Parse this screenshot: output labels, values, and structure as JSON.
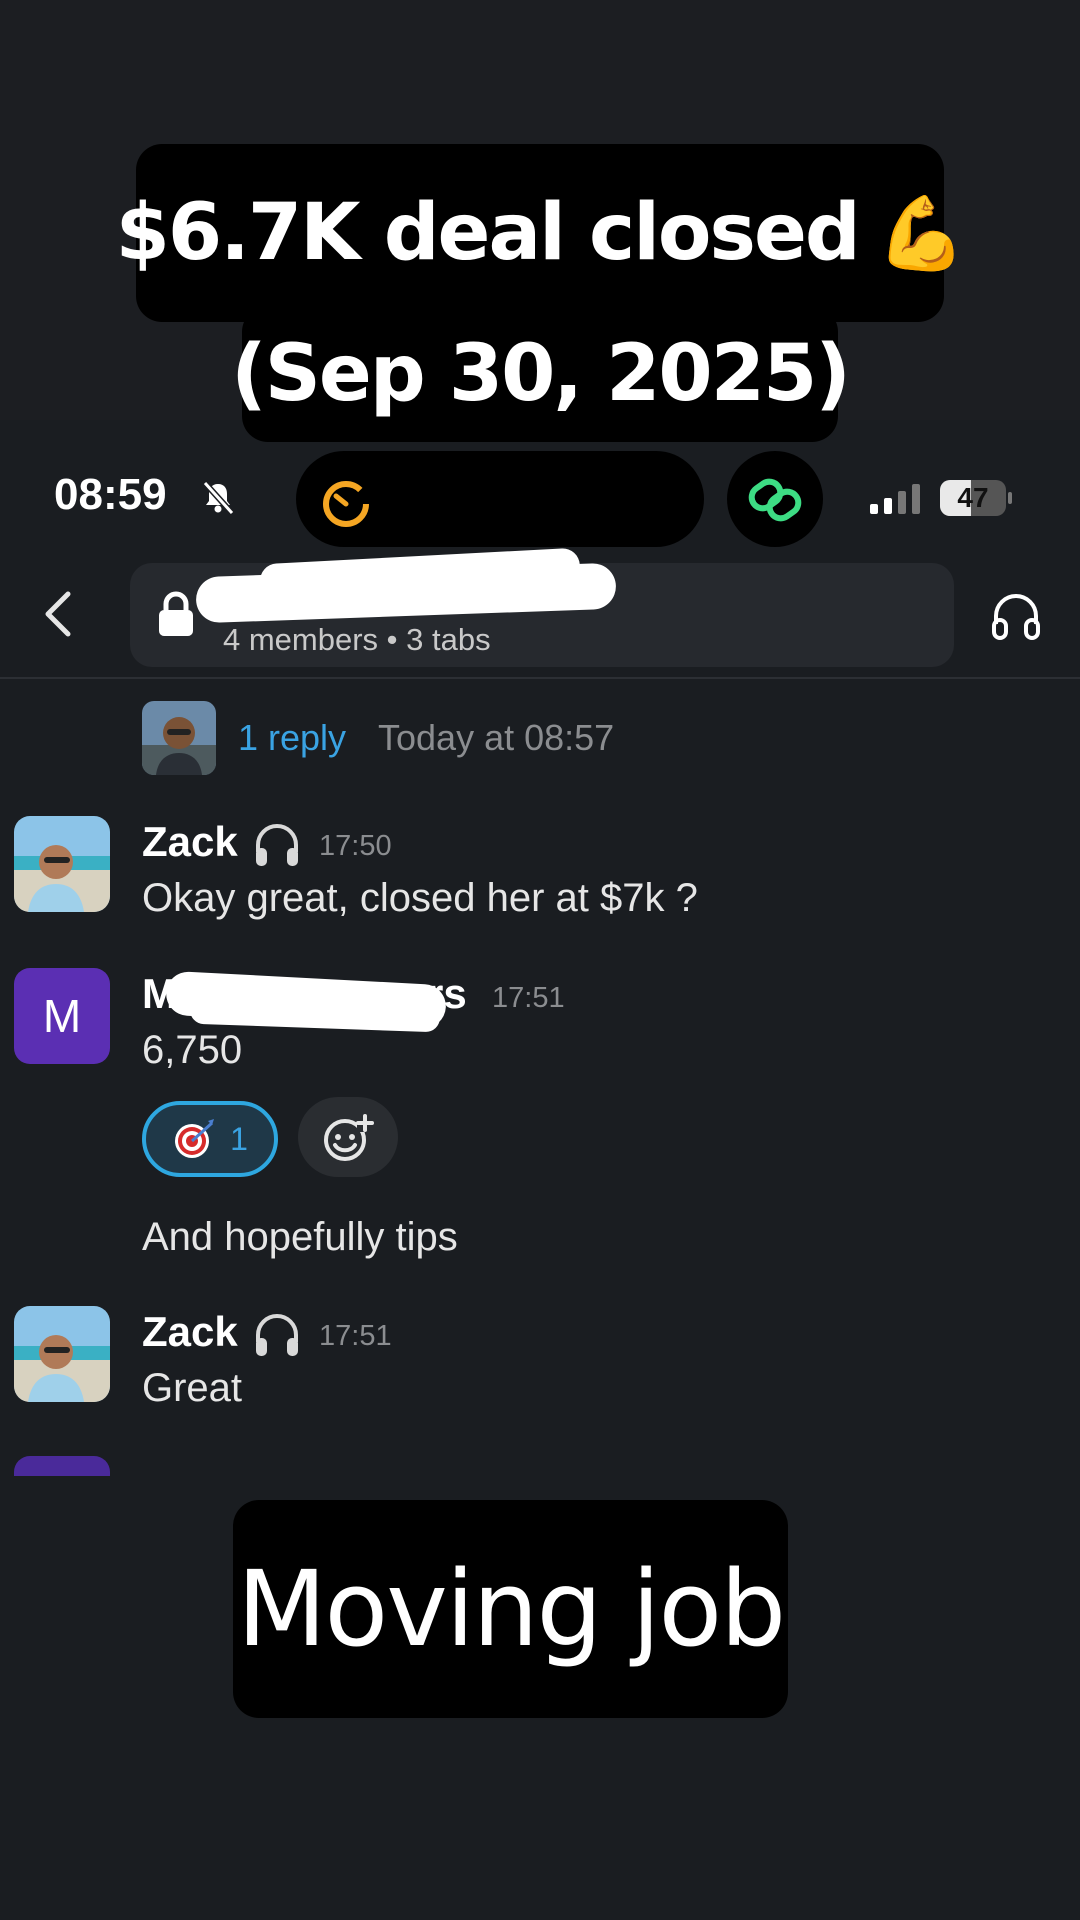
{
  "captions": {
    "top_line1": "$6.7K deal closed",
    "top_emoji": "💪",
    "top_line2": "(Sep 30, 2025)",
    "bottom": "Moving job"
  },
  "status_bar": {
    "time": "08:59",
    "battery": "47",
    "battery_level": 0.47
  },
  "header": {
    "channel_meta": "4 members • 3 tabs"
  },
  "thread": {
    "reply_link": "1 reply",
    "reply_time": "Today at 08:57"
  },
  "messages": [
    {
      "sender": "Zack",
      "time": "17:50",
      "text": "Okay great, closed her at $7k ?"
    },
    {
      "sender": "M",
      "sender_suffix": "rs",
      "avatar_letter": "M",
      "time": "17:51",
      "text": "6,750",
      "followup": "And hopefully tips"
    },
    {
      "sender": "Zack",
      "time": "17:51",
      "text": "Great"
    }
  ],
  "reaction": {
    "count": "1"
  },
  "colors": {
    "background": "#1a1d21",
    "link": "#3aa3e3",
    "avatar_purple": "#5b2fb3",
    "timer_orange": "#f5a623",
    "link_green": "#3ddc84"
  }
}
